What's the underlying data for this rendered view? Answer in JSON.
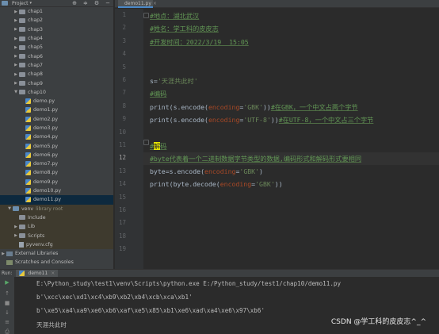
{
  "project_panel": {
    "title": "Project",
    "tree": [
      {
        "label": "chap1",
        "type": "folder",
        "indent": 1
      },
      {
        "label": "chap2",
        "type": "folder",
        "indent": 1
      },
      {
        "label": "chap3",
        "type": "folder",
        "indent": 1
      },
      {
        "label": "chap4",
        "type": "folder",
        "indent": 1
      },
      {
        "label": "chap5",
        "type": "folder",
        "indent": 1
      },
      {
        "label": "chap6",
        "type": "folder",
        "indent": 1
      },
      {
        "label": "chap7",
        "type": "folder",
        "indent": 1
      },
      {
        "label": "chap8",
        "type": "folder",
        "indent": 1
      },
      {
        "label": "chap9",
        "type": "folder",
        "indent": 1
      },
      {
        "label": "chap10",
        "type": "folder-open",
        "indent": 1
      },
      {
        "label": "demo.py",
        "type": "py",
        "indent": 2
      },
      {
        "label": "demo1.py",
        "type": "py",
        "indent": 2
      },
      {
        "label": "demo2.py",
        "type": "py",
        "indent": 2
      },
      {
        "label": "demo3.py",
        "type": "py",
        "indent": 2
      },
      {
        "label": "demo4.py",
        "type": "py",
        "indent": 2
      },
      {
        "label": "demo5.py",
        "type": "py",
        "indent": 2
      },
      {
        "label": "demo6.py",
        "type": "py",
        "indent": 2
      },
      {
        "label": "demo7.py",
        "type": "py",
        "indent": 2
      },
      {
        "label": "demo8.py",
        "type": "py",
        "indent": 2
      },
      {
        "label": "demo9.py",
        "type": "py",
        "indent": 2
      },
      {
        "label": "demo10.py",
        "type": "py",
        "indent": 2
      },
      {
        "label": "demo11.py",
        "type": "py",
        "indent": 2,
        "selected": true
      },
      {
        "label": "venv",
        "type": "folder-open",
        "indent": 0,
        "suffix": "library root"
      },
      {
        "label": "Include",
        "type": "folder",
        "indent": 1,
        "noarrow": true
      },
      {
        "label": "Lib",
        "type": "folder",
        "indent": 1
      },
      {
        "label": "Scripts",
        "type": "folder",
        "indent": 1
      },
      {
        "label": "pyvenv.cfg",
        "type": "cfg",
        "indent": 1
      },
      {
        "label": "External Libraries",
        "type": "lib",
        "indent": -1
      },
      {
        "label": "Scratches and Consoles",
        "type": "scratch",
        "indent": -1,
        "noarrow": true
      }
    ]
  },
  "editor": {
    "tab_label": "demo11.py",
    "lines": [
      {
        "n": "1",
        "segs": [
          {
            "t": "#地点：湖北武汉",
            "c": "c-com"
          }
        ]
      },
      {
        "n": "2",
        "segs": [
          {
            "t": "#姓名：学工科的皮皮志",
            "c": "c-com"
          }
        ]
      },
      {
        "n": "3",
        "segs": [
          {
            "t": "#开发时间：2022/3/19  15:05",
            "c": "c-com"
          }
        ]
      },
      {
        "n": "4",
        "segs": []
      },
      {
        "n": "5",
        "segs": []
      },
      {
        "n": "6",
        "segs": [
          {
            "t": "s=",
            "c": "c-fn"
          },
          {
            "t": "'天涯共此时'",
            "c": "c-str"
          }
        ]
      },
      {
        "n": "7",
        "segs": [
          {
            "t": "#编码",
            "c": "c-com"
          }
        ]
      },
      {
        "n": "8",
        "segs": [
          {
            "t": "print(s.encode(",
            "c": "c-fn"
          },
          {
            "t": "encoding",
            "c": "c-kw"
          },
          {
            "t": "=",
            "c": "c-fn"
          },
          {
            "t": "'GBK'",
            "c": "c-str"
          },
          {
            "t": "))",
            "c": "c-fn"
          },
          {
            "t": "#在GBK，一个中文占两个字节",
            "c": "c-com"
          }
        ]
      },
      {
        "n": "9",
        "segs": [
          {
            "t": "print(s.encode(",
            "c": "c-fn"
          },
          {
            "t": "encoding",
            "c": "c-kw"
          },
          {
            "t": "=",
            "c": "c-fn"
          },
          {
            "t": "'UTF-8'",
            "c": "c-str"
          },
          {
            "t": "))",
            "c": "c-fn"
          },
          {
            "t": "#在UTF-8，一个中文占三个字节",
            "c": "c-com"
          }
        ]
      },
      {
        "n": "10",
        "segs": []
      },
      {
        "n": "11",
        "segs": [
          {
            "t": "#",
            "c": "c-com"
          },
          {
            "t": "解",
            "c": "c-cursor"
          },
          {
            "t": "码",
            "c": "c-com"
          }
        ]
      },
      {
        "n": "12",
        "segs": [
          {
            "t": "#byte代表着一个二进制数据字节类型的数据,编码形式和解码形式要相同",
            "c": "c-com"
          }
        ],
        "current": true
      },
      {
        "n": "13",
        "segs": [
          {
            "t": "byte=s.encode(",
            "c": "c-fn"
          },
          {
            "t": "encoding",
            "c": "c-kw"
          },
          {
            "t": "=",
            "c": "c-fn"
          },
          {
            "t": "'GBK'",
            "c": "c-str"
          },
          {
            "t": ")",
            "c": "c-fn"
          }
        ]
      },
      {
        "n": "14",
        "segs": [
          {
            "t": "print(byte.decode(",
            "c": "c-fn"
          },
          {
            "t": "encoding",
            "c": "c-kw"
          },
          {
            "t": "=",
            "c": "c-fn"
          },
          {
            "t": "'GBK'",
            "c": "c-str"
          },
          {
            "t": "))",
            "c": "c-fn"
          }
        ]
      },
      {
        "n": "15",
        "segs": []
      },
      {
        "n": "16",
        "segs": []
      },
      {
        "n": "17",
        "segs": []
      },
      {
        "n": "18",
        "segs": []
      },
      {
        "n": "19",
        "segs": []
      }
    ]
  },
  "run_panel": {
    "label": "Run:",
    "tab_label": "demo11",
    "output": [
      "E:\\Python_study\\test1\\venv\\Scripts\\python.exe E:/Python_study/test1/chap10/demo11.py",
      "b'\\xcc\\xec\\xd1\\xc4\\xb9\\xb2\\xb4\\xcb\\xca\\xb1'",
      "b'\\xe5\\xa4\\xa9\\xe6\\xb6\\xaf\\xe5\\x85\\xb1\\xe6\\xad\\xa4\\xe6\\x97\\xb6'",
      "天涯共此时"
    ]
  },
  "watermark": "CSDN @学工科的皮皮志^_^"
}
